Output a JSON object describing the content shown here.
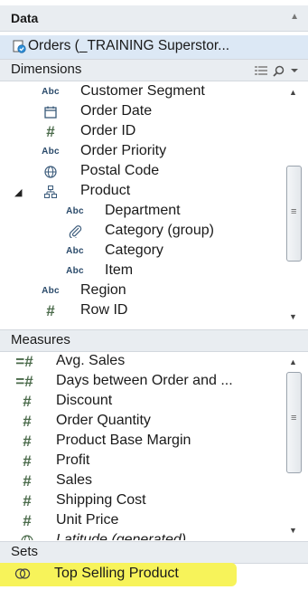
{
  "panel": {
    "title": "Data",
    "data_source": "Orders (_TRAINING Superstor..."
  },
  "dimensions": {
    "header": "Dimensions",
    "items": [
      {
        "icon": "Abc",
        "label": "Customer Segment"
      },
      {
        "icon": "calendar",
        "label": "Order Date"
      },
      {
        "icon": "#",
        "label": "Order ID"
      },
      {
        "icon": "Abc",
        "label": "Order Priority"
      },
      {
        "icon": "globe",
        "label": "Postal Code"
      },
      {
        "icon": "hierarchy",
        "label": "Product"
      },
      {
        "icon": "Abc",
        "label": "Department"
      },
      {
        "icon": "paperclip",
        "label": "Category (group)"
      },
      {
        "icon": "Abc",
        "label": "Category"
      },
      {
        "icon": "Abc",
        "label": "Item"
      },
      {
        "icon": "Abc",
        "label": "Region"
      },
      {
        "icon": "#",
        "label": "Row ID"
      }
    ]
  },
  "measures": {
    "header": "Measures",
    "items": [
      {
        "icon": "=#",
        "label": "Avg. Sales"
      },
      {
        "icon": "=#",
        "label": "Days between Order and ..."
      },
      {
        "icon": "#",
        "label": "Discount"
      },
      {
        "icon": "#",
        "label": "Order Quantity"
      },
      {
        "icon": "#",
        "label": "Product Base Margin"
      },
      {
        "icon": "#",
        "label": "Profit"
      },
      {
        "icon": "#",
        "label": "Sales"
      },
      {
        "icon": "#",
        "label": "Shipping Cost"
      },
      {
        "icon": "#",
        "label": "Unit Price"
      },
      {
        "icon": "globe",
        "label": "Latitude (generated)"
      }
    ]
  },
  "sets": {
    "header": "Sets",
    "items": [
      {
        "icon": "set",
        "label": "Top Selling Product"
      }
    ]
  },
  "colors": {
    "highlight": "#f7f35a",
    "header_bg": "#e9edf1",
    "datasource_bg": "#dce8f5"
  }
}
